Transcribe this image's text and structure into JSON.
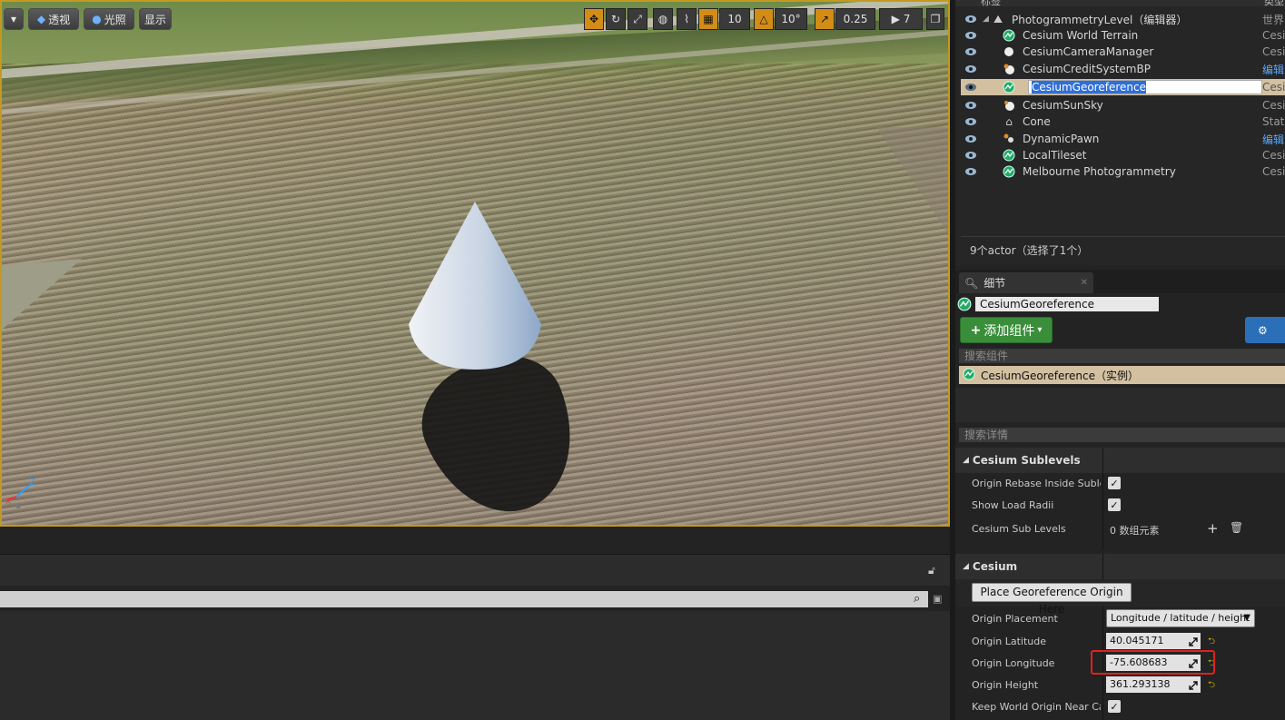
{
  "viewport": {
    "view_mode_label": "透视",
    "lit_label": "光照",
    "show_label": "显示",
    "grid_snap_value": "10",
    "rotation_snap_value": "10°",
    "scale_snap_value": "0.25",
    "camera_speed_value": "7"
  },
  "outliner": {
    "header_name": "标签",
    "header_type": "类型",
    "rows": [
      {
        "name": "PhotogrammetryLevel（编辑器）",
        "type": "世界",
        "icon": "world-icon"
      },
      {
        "name": "Cesium World Terrain",
        "type": "Cesiu",
        "icon": "cesium-icon"
      },
      {
        "name": "CesiumCameraManager",
        "type": "Cesiu",
        "icon": "sphere-icon"
      },
      {
        "name": "CesiumCreditSystemBP",
        "type": "编辑",
        "icon": "blueprint-icon"
      },
      {
        "name": "CesiumGeoreference",
        "type": "Cesiu",
        "icon": "cesium-icon"
      },
      {
        "name": "CesiumSunSky",
        "type": "Cesiu",
        "icon": "sphere-icon"
      },
      {
        "name": "Cone",
        "type": "Stati",
        "icon": "static-mesh-icon"
      },
      {
        "name": "DynamicPawn",
        "type": "编辑",
        "icon": "pawn-icon"
      },
      {
        "name": "LocalTileset",
        "type": "Cesiu",
        "icon": "cesium-icon"
      },
      {
        "name": "Melbourne Photogrammetry",
        "type": "Cesiu",
        "icon": "cesium-icon"
      }
    ],
    "status": "9个actor（选择了1个）"
  },
  "details": {
    "tab_label": "细节",
    "actor_name": "CesiumGeoreference",
    "add_component_label": "添加组件",
    "search_components_placeholder": "搜索组件",
    "component_row": "CesiumGeoreference（实例）",
    "search_details_placeholder": "搜索详情",
    "sublevels_category": "Cesium Sublevels",
    "origin_rebase_label": "Origin Rebase Inside Sublevels",
    "show_load_radii_label": "Show Load Radii",
    "sub_levels_label": "Cesium Sub Levels",
    "sub_levels_value": "0 数组元素",
    "cesium_category": "Cesium",
    "place_origin_button": "Place Georeference Origin Here",
    "origin_placement_label": "Origin Placement",
    "origin_placement_value": "Longitude / latitude / height",
    "origin_latitude_label": "Origin Latitude",
    "origin_latitude_value": "40.045171",
    "origin_longitude_label": "Origin Longitude",
    "origin_longitude_value": "-75.608683",
    "origin_height_label": "Origin Height",
    "origin_height_value": "361.293138",
    "keep_world_origin_label": "Keep World Origin Near Camera"
  },
  "colors": {
    "selection": "#d2c0a0",
    "snap_orange": "#d38d17",
    "highlight_red": "#e0211d",
    "add_green": "#3a8e3a"
  }
}
